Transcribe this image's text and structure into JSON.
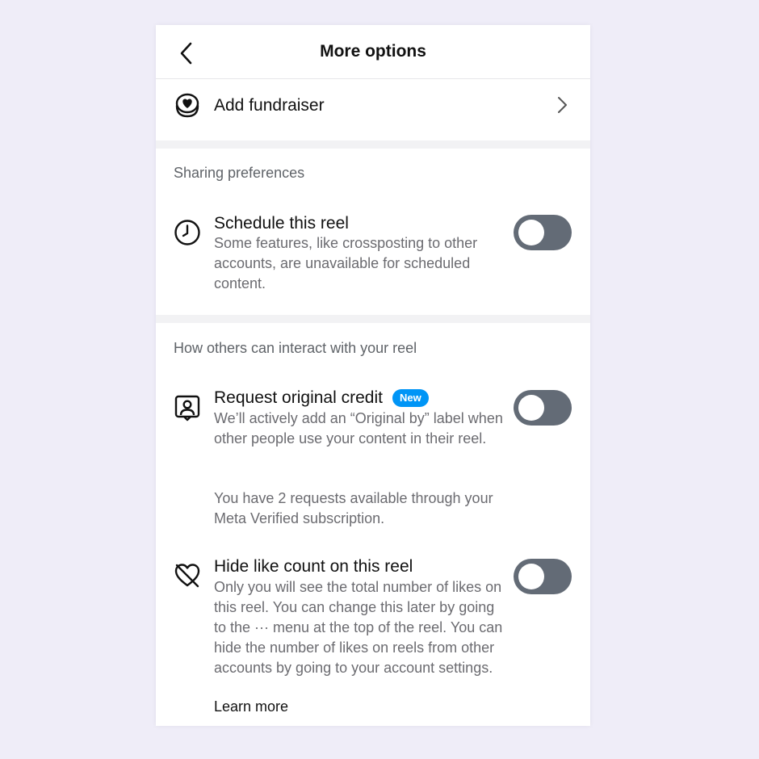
{
  "header": {
    "title": "More options",
    "back_icon": "chevron-left-icon"
  },
  "fundraiser": {
    "label": "Add fundraiser",
    "icon": "heart-donation-icon",
    "chevron_icon": "chevron-right-icon"
  },
  "sharing": {
    "section_title": "Sharing preferences",
    "schedule": {
      "title": "Schedule this reel",
      "description": "Some features, like crossposting to other accounts, are unavailable for scheduled content.",
      "icon": "clock-icon",
      "enabled": false
    }
  },
  "interaction": {
    "section_title": "How others can interact with your reel",
    "original_credit": {
      "title": "Request original credit",
      "badge": "New",
      "description": "We’ll actively add an “Original by” label when other people use your content in their reel.",
      "note": "You have 2 requests available through your Meta Verified subscription.",
      "icon": "person-frame-icon",
      "enabled": false
    },
    "hide_likes": {
      "title": "Hide like count on this reel",
      "description": "Only you will see the total number of likes on this reel. You can change this later by going to the ··· menu at the top of the reel. You can hide the number of likes on reels from other accounts by going to your account settings.",
      "learn_more": "Learn more",
      "icon": "heart-slash-icon",
      "enabled": false
    }
  },
  "colors": {
    "background": "#efedf8",
    "toggle_off": "#636b76",
    "badge": "#0095f6"
  }
}
